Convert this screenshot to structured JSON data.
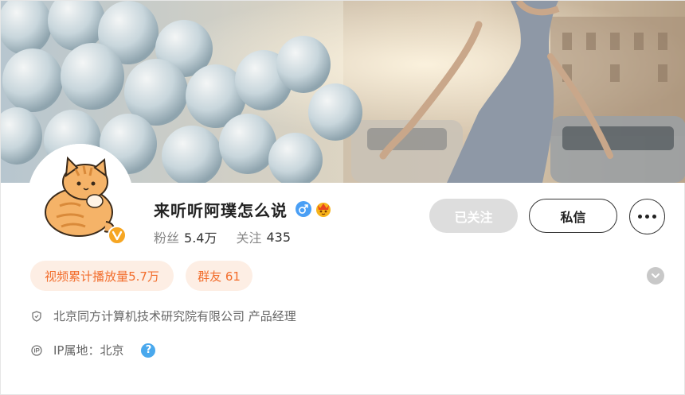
{
  "profile": {
    "name": "来听听阿璞怎么说",
    "fans_label": "粉丝",
    "fans_count": "5.4万",
    "follow_label": "关注",
    "follow_count": "435"
  },
  "actions": {
    "followed_label": "已关注",
    "message_label": "私信"
  },
  "tags": {
    "video_plays": "视频累计播放量5.7万",
    "group_friends": "群友 61"
  },
  "info": {
    "company": "北京同方计算机技术研究院有限公司 产品经理",
    "ip_location": "IP属地：北京",
    "help_glyph": "?"
  },
  "icons": {
    "gender": "male-icon",
    "crown": "crown-icon",
    "verified": "verified-badge-icon",
    "shield": "shield-icon",
    "ip": "ip-icon",
    "expand": "chevron-down-icon",
    "more": "more-icon"
  },
  "colors": {
    "accent_orange": "#f26d2c",
    "tag_bg": "#fdeee4",
    "verified_gold": "#f6a623",
    "gender_blue": "#4a9ff5",
    "followed_bg": "#dddddd"
  }
}
